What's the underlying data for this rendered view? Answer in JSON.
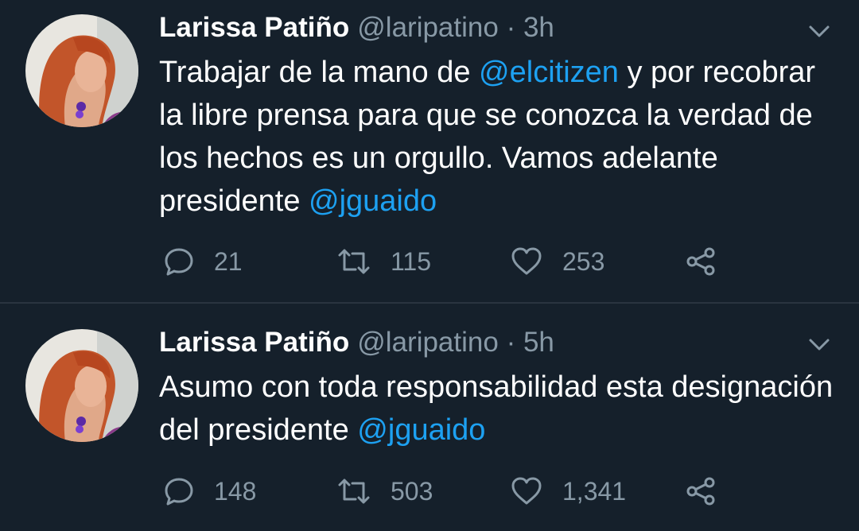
{
  "tweets": [
    {
      "name": "Larissa Patiño",
      "handle": "@laripatino",
      "separator": "·",
      "time": "3h",
      "body": [
        {
          "text": "Trabajar de la mano de "
        },
        {
          "text": "@elcitizen",
          "mention": true
        },
        {
          "text": " y por recobrar la libre prensa para que se conozca la verdad de los hechos es un orgullo. Vamos adelante presidente "
        },
        {
          "text": "@jguaido",
          "mention": true
        }
      ],
      "replies": "21",
      "retweets": "115",
      "likes": "253"
    },
    {
      "name": "Larissa Patiño",
      "handle": "@laripatino",
      "separator": "·",
      "time": "5h",
      "body": [
        {
          "text": "Asumo con toda responsabilidad esta designación del presidente "
        },
        {
          "text": "@jguaido",
          "mention": true
        }
      ],
      "replies": "148",
      "retweets": "503",
      "likes": "1,341"
    }
  ],
  "colors": {
    "background": "#15202b",
    "text": "#ffffff",
    "secondary": "#8899a6",
    "mention": "#1da1f2",
    "divider": "#2a3440"
  },
  "icons": {
    "reply": "reply-icon",
    "retweet": "retweet-icon",
    "like": "heart-icon",
    "share": "share-icon",
    "menu": "chevron-down-icon"
  }
}
